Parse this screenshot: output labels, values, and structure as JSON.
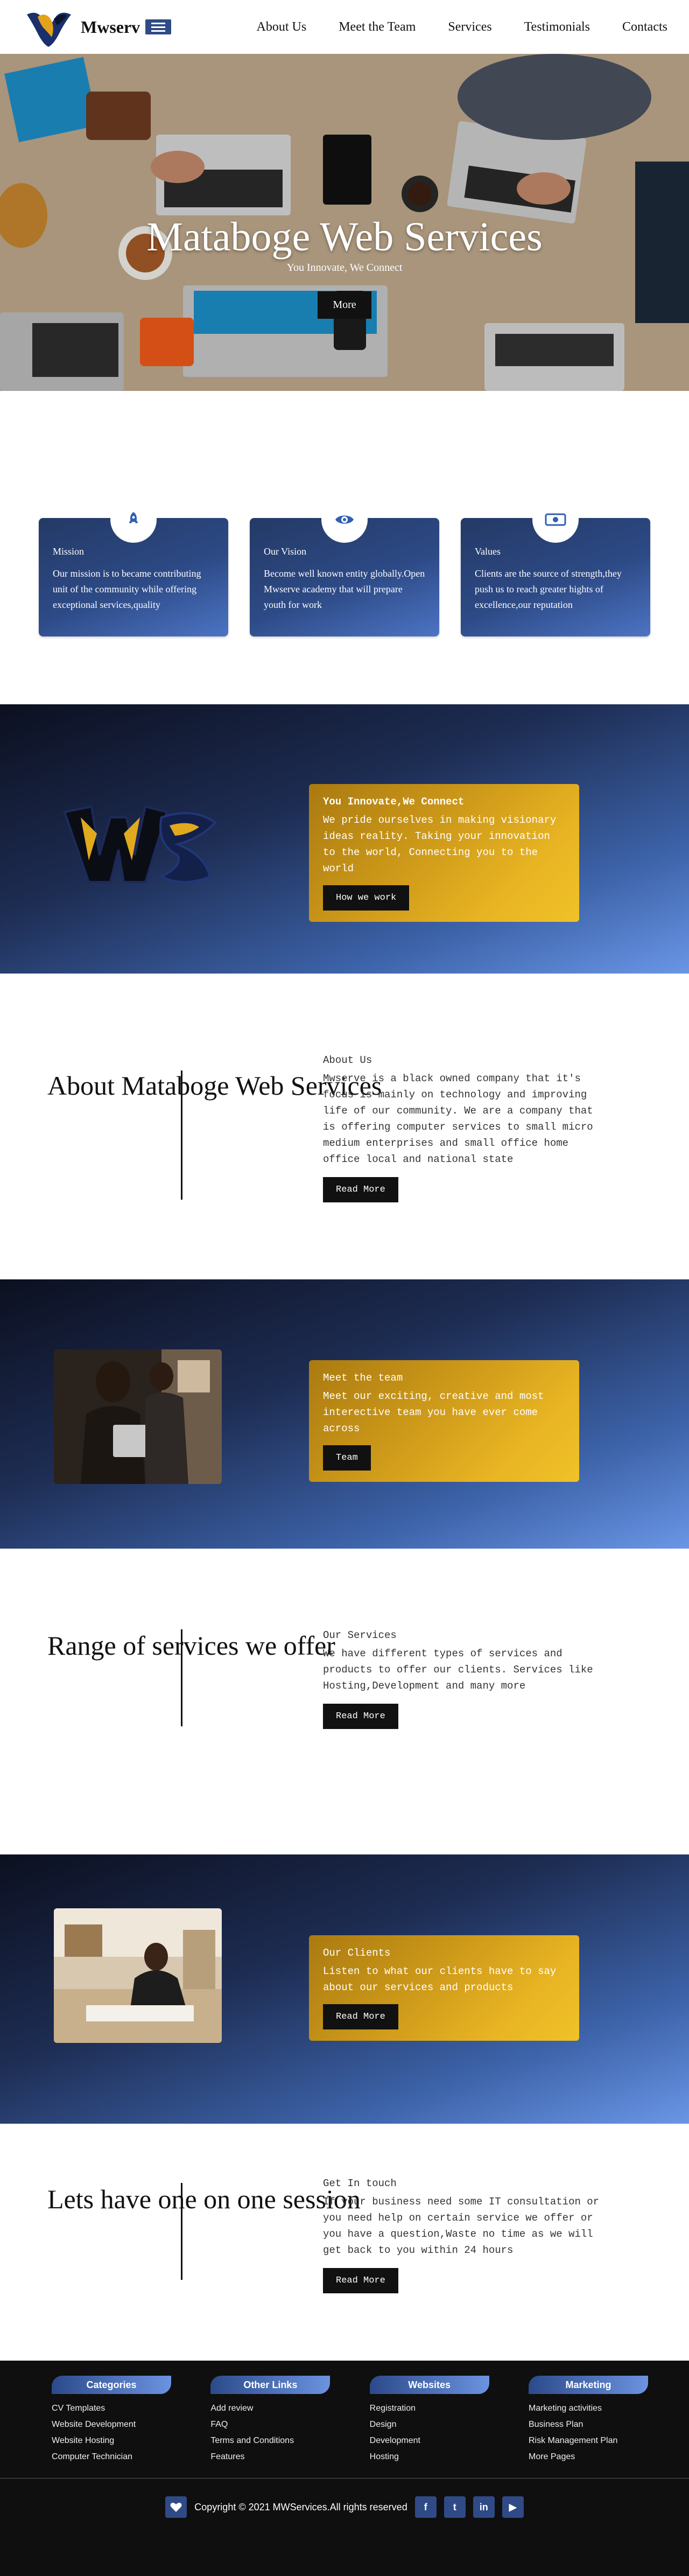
{
  "brand": {
    "name": "Mwserv"
  },
  "nav": {
    "links": [
      "About Us",
      "Meet the Team",
      "Services",
      "Testimonials",
      "Contacts"
    ]
  },
  "hero": {
    "title": "Mataboge Web Services",
    "subtitle": "You Innovate, We Connect",
    "button": "More"
  },
  "cards": [
    {
      "title": "Mission",
      "text": "Our mission is to became contributing unit of the community while offering exceptional services,quality",
      "icon": "rocket-icon"
    },
    {
      "title": "Our Vision",
      "text": "Become well known entity globally.Open Mwserve academy that will prepare youth for work",
      "icon": "eye-icon"
    },
    {
      "title": "Values",
      "text": "Clients are the source of strength,they push us to reach greater hights of excellence,our reputation",
      "icon": "money-icon"
    }
  ],
  "innovate": {
    "title": "You Innovate,We Connect",
    "text": "We pride ourselves in making visionary ideas reality. Taking your innovation to the world, Connecting you to the world",
    "button": "How we work"
  },
  "about": {
    "heading": "About Mataboge Web Services",
    "title": "About Us",
    "text": "Mwserve is a black owned company that it's focus is mainly on technology and improving life of our community. We are a company that is offering computer services to small micro medium enterprises and small office home office local and national state",
    "button": "Read More"
  },
  "team": {
    "title": "Meet the team",
    "text": "Meet our exciting, creative and most interective team you have ever come across",
    "button": "Team"
  },
  "services": {
    "heading": "Range of services we offer",
    "title": "Our Services",
    "text": "We have different types of services and products to offer our clients. Services like Hosting,Development and many more",
    "button": "Read More"
  },
  "clients": {
    "title": "Our Clients",
    "text": "Listen to what our clients have to say about our services and products",
    "button": "Read More"
  },
  "contact": {
    "heading": "Lets have one on one session",
    "title": "Get In touch",
    "text": "If your business need some IT consultation or you need help on certain service we offer or you have a question,Waste no time as we will get back to you within 24 hours",
    "button": "Read More"
  },
  "footer": {
    "columns": [
      {
        "title": "Categories",
        "items": [
          "CV Templates",
          "Website Development",
          "Website Hosting",
          "Computer Technician"
        ]
      },
      {
        "title": "Other Links",
        "items": [
          "Add review",
          "FAQ",
          "Terms and Conditions",
          "Features"
        ]
      },
      {
        "title": "Websites",
        "items": [
          "Registration",
          "Design",
          "Development",
          "Hosting"
        ]
      },
      {
        "title": "Marketing",
        "items": [
          "Marketing activities",
          "Business Plan",
          "Risk Management Plan",
          "More Pages"
        ]
      }
    ],
    "copyright": "Copyright © 2021 MWServices.All rights reserved",
    "social": {
      "facebook": "f",
      "twitter": "t",
      "linkedin": "in",
      "youtube": "▶"
    }
  },
  "colors": {
    "accent": "#2f4a86",
    "gold": "#e8b423",
    "dark": "#111111"
  }
}
